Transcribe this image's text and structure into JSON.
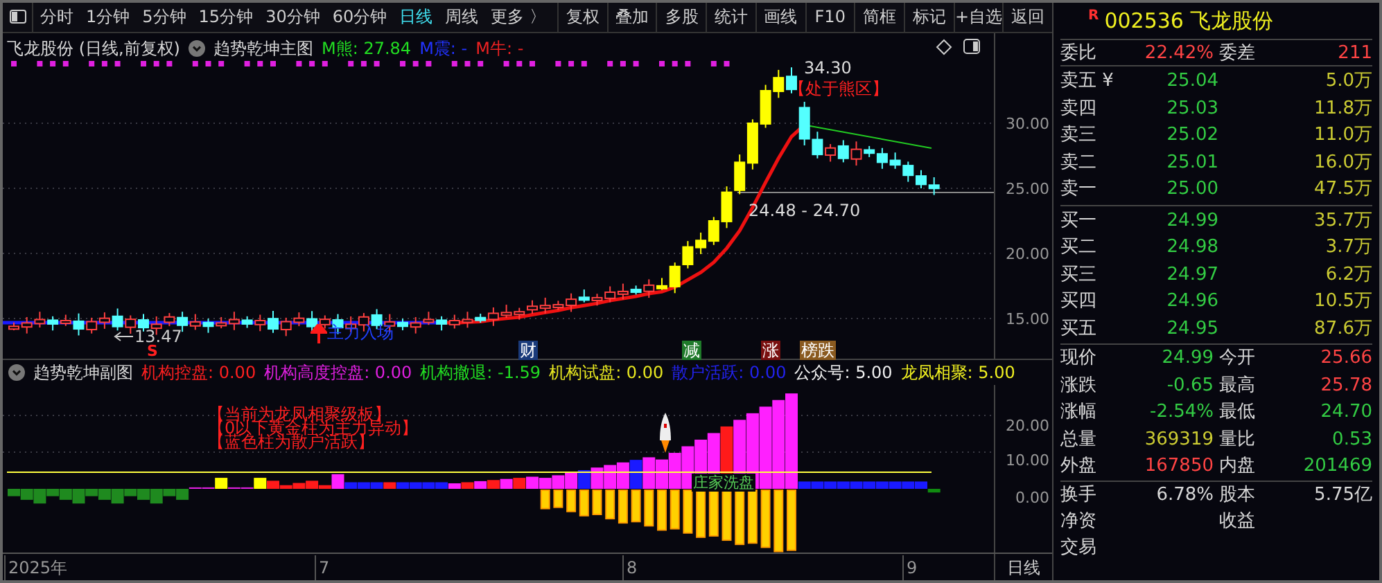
{
  "toolbar": {
    "periods": [
      {
        "label": "分时",
        "selected": false
      },
      {
        "label": "1分钟",
        "selected": false
      },
      {
        "label": "5分钟",
        "selected": false
      },
      {
        "label": "15分钟",
        "selected": false
      },
      {
        "label": "30分钟",
        "selected": false
      },
      {
        "label": "60分钟",
        "selected": false
      },
      {
        "label": "日线",
        "selected": true
      },
      {
        "label": "周线",
        "selected": false
      },
      {
        "label": "更多 〉",
        "selected": false
      }
    ],
    "buttons": [
      "复权",
      "叠加",
      "多股",
      "统计",
      "画线",
      "F10",
      "简框",
      "标记",
      "+自选",
      "返回"
    ]
  },
  "main_chart": {
    "stock_label": "飞龙股份 (日线,前复权)",
    "indicator": "趋势乾坤主图",
    "readouts": [
      {
        "text": "M熊: 27.84",
        "color": "#22dd22"
      },
      {
        "text": "M震: -",
        "color": "#2233ff"
      },
      {
        "text": "M牛: -",
        "color": "#ee2222"
      }
    ],
    "y_axis": [
      "30.00",
      "25.00",
      "20.00",
      "15.00"
    ],
    "high_label": "34.30",
    "zone_label": "【处于熊区】",
    "range_label": "24.48 - 24.70",
    "low_label": "13.47",
    "entry_label": "主力入场",
    "signal_label": "S",
    "events": [
      {
        "text": "财",
        "color": "#1a3a7a"
      },
      {
        "text": "减",
        "color": "#1f7a2a"
      },
      {
        "text": "涨",
        "color": "#7a1010"
      },
      {
        "text": "榜跌",
        "color": "#8a5a20"
      }
    ]
  },
  "sub_chart": {
    "indicator": "趋势乾坤副图",
    "readouts": [
      {
        "text": "机构控盘: 0.00",
        "color": "#ff2020"
      },
      {
        "text": "机构高度控盘: 0.00",
        "color": "#e020e0"
      },
      {
        "text": "机构撤退: -1.59",
        "color": "#22dd22"
      },
      {
        "text": "机构试盘: 0.00",
        "color": "#e8e820"
      },
      {
        "text": "散户活跃: 0.00",
        "color": "#2222ee"
      },
      {
        "text": "公众号: 5.00",
        "color": "#f0f0f0"
      },
      {
        "text": "龙凤相聚: 5.00",
        "color": "#f0f020"
      }
    ],
    "notes": [
      "【当前为龙凤相聚级板】",
      "【0以下黄金柱为主力异动】",
      "【蓝色柱为散户活跃】"
    ],
    "wash_label": "庄家洗盘",
    "y_axis": [
      "20.00",
      "10.00",
      "0.00"
    ]
  },
  "x_axis": {
    "labels": [
      "2025年",
      "7",
      "8",
      "9"
    ],
    "period": "日线"
  },
  "quote": {
    "code": "002536 飞龙股份",
    "badge": "R",
    "ratio": [
      {
        "label": "委比",
        "value": "22.42%",
        "color": "#ff4444"
      },
      {
        "label": "委差",
        "value": "211",
        "color": "#ff4444"
      }
    ],
    "asks": [
      {
        "label": "卖五 ¥",
        "price": "25.04",
        "volume": "5.0万"
      },
      {
        "label": "卖四",
        "price": "25.03",
        "volume": "11.8万"
      },
      {
        "label": "卖三",
        "price": "25.02",
        "volume": "11.0万"
      },
      {
        "label": "卖二",
        "price": "25.01",
        "volume": "16.0万"
      },
      {
        "label": "卖一",
        "price": "25.00",
        "volume": "47.5万"
      }
    ],
    "bids": [
      {
        "label": "买一",
        "price": "24.99",
        "volume": "35.7万"
      },
      {
        "label": "买二",
        "price": "24.98",
        "volume": "3.7万"
      },
      {
        "label": "买三",
        "price": "24.97",
        "volume": "6.2万"
      },
      {
        "label": "买四",
        "price": "24.96",
        "volume": "10.5万"
      },
      {
        "label": "买五",
        "price": "24.95",
        "volume": "87.6万"
      }
    ],
    "stats": [
      {
        "label": "现价",
        "value": "24.99",
        "color": "#33cc44"
      },
      {
        "label": "今开",
        "value": "25.66",
        "color": "#ff4444"
      },
      {
        "label": "涨跌",
        "value": "-0.65",
        "color": "#33cc44"
      },
      {
        "label": "最高",
        "value": "25.78",
        "color": "#ff4444"
      },
      {
        "label": "涨幅",
        "value": "-2.54%",
        "color": "#33cc44"
      },
      {
        "label": "最低",
        "value": "24.70",
        "color": "#33cc44"
      },
      {
        "label": "总量",
        "value": "369319",
        "color": "#cccc33"
      },
      {
        "label": "量比",
        "value": "0.53",
        "color": "#33cc44"
      },
      {
        "label": "外盘",
        "value": "167850",
        "color": "#ff4444"
      },
      {
        "label": "内盘",
        "value": "201469",
        "color": "#33cc44"
      }
    ],
    "extra": [
      {
        "label": "换手",
        "value": "6.78%"
      },
      {
        "label": "股本",
        "value": "5.75亿"
      },
      {
        "label": "净资"
      },
      {
        "label": "收益"
      },
      {
        "label": "交易"
      }
    ]
  }
}
